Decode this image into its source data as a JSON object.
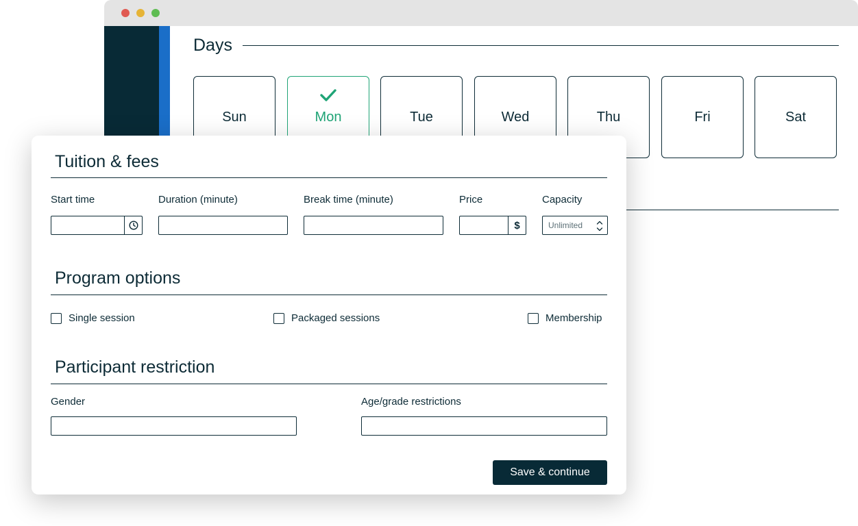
{
  "browser": {
    "days": {
      "title": "Days",
      "items": [
        {
          "label": "Sun",
          "selected": false
        },
        {
          "label": "Mon",
          "selected": true
        },
        {
          "label": "Tue",
          "selected": false
        },
        {
          "label": "Wed",
          "selected": false
        },
        {
          "label": "Thu",
          "selected": false
        },
        {
          "label": "Fri",
          "selected": false
        },
        {
          "label": "Sat",
          "selected": false
        }
      ]
    }
  },
  "tuition": {
    "title": "Tuition & fees",
    "start_time": {
      "label": "Start time",
      "value": "",
      "icon": "clock-icon"
    },
    "duration": {
      "label": "Duration (minute)",
      "value": ""
    },
    "break_time": {
      "label": "Break time (minute)",
      "value": ""
    },
    "price": {
      "label": "Price",
      "value": "",
      "currency_symbol": "$"
    },
    "capacity": {
      "label": "Capacity",
      "value": "Unlimited"
    }
  },
  "program_options": {
    "title": "Program options",
    "options": [
      {
        "label": "Single session",
        "checked": false
      },
      {
        "label": "Packaged sessions",
        "checked": false
      },
      {
        "label": "Membership",
        "checked": false
      }
    ]
  },
  "participant_restriction": {
    "title": "Participant restriction",
    "gender": {
      "label": "Gender",
      "value": ""
    },
    "age_grade": {
      "label": "Age/grade restrictions",
      "value": ""
    }
  },
  "actions": {
    "save_label": "Save & continue"
  },
  "colors": {
    "navy": "#082a36",
    "accent_green": "#1fa476",
    "sidebar_blue": "#1a6ec8",
    "window_red": "#e05a52",
    "window_yellow": "#e6b437",
    "window_green": "#5fbd53"
  }
}
